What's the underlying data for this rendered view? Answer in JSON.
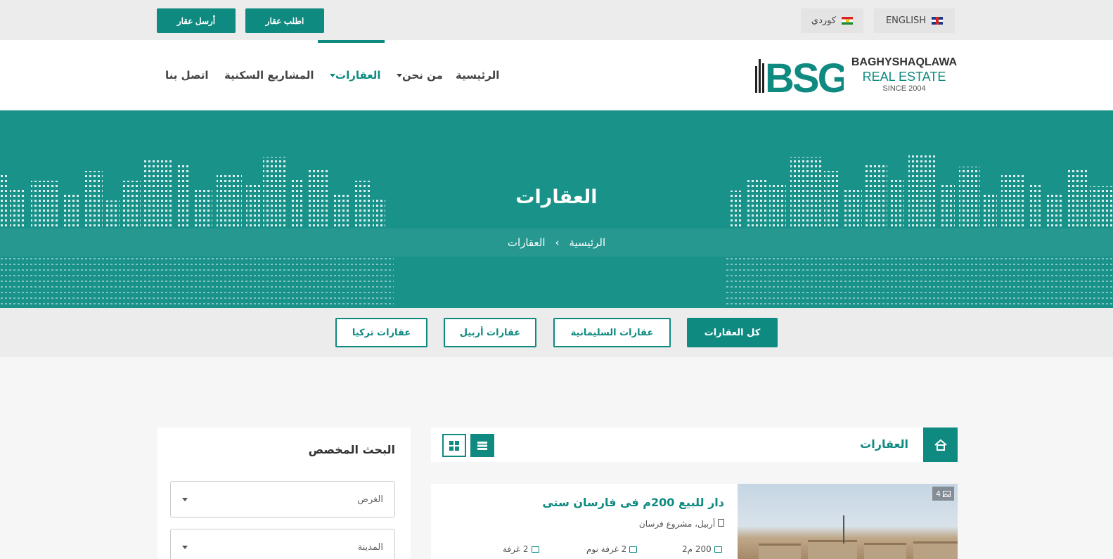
{
  "topbar": {
    "send_property": "أرسل عقار",
    "request_property": "اطلب عقار",
    "lang_kurdish": "كوردي",
    "lang_english": "ENGLISH"
  },
  "logo": {
    "mark": "BSG",
    "line1": "BAGHYSHAQLAWA",
    "line2": "REAL ESTATE",
    "line3": "SINCE 2004"
  },
  "nav": {
    "home": "الرئيسية",
    "about": "من نحن",
    "properties": "العقارات",
    "projects": "المشاريع السكنية",
    "contact": "اتصل بنا"
  },
  "hero": {
    "title": "العقارات",
    "crumb_home": "الرئيسية",
    "crumb_sep": "›",
    "crumb_current": "العقارات"
  },
  "filters": {
    "all": "كل العقارات",
    "sulaymaniyah": "عقارات السليمانية",
    "erbil": "عقارات أربيل",
    "turkey": "عقارات تركيا"
  },
  "listing": {
    "title": "العقارات"
  },
  "sidebar": {
    "title": "البحث المخصص",
    "purpose_placeholder": "الغرض",
    "city_placeholder": "المدينة"
  },
  "card": {
    "title": "دار للبيع 200م فی فارسان ستی",
    "location": "أربيل، مشروع فرسان",
    "image_count": "4",
    "area": "200 م2",
    "bedrooms": "2 غرفة نوم",
    "rooms": "2 غرفة"
  },
  "colors": {
    "accent": "#0e8a80",
    "hero": "#19928a"
  }
}
